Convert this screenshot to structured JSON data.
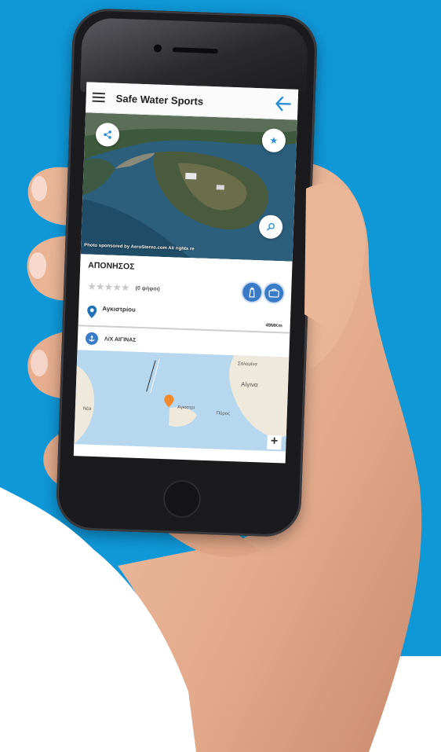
{
  "app": {
    "title": "Safe Water Sports"
  },
  "photo": {
    "credit": "Photo sponsored by AeroStereo.com All rights re"
  },
  "place": {
    "name": "ΑΠΟΝΗΣΟΣ",
    "rating_stars": "★★★★★",
    "rating_votes": "(0 ψήφοι)",
    "location": "Αγκιστρίου",
    "distance": "49ΜKm",
    "port": "Λ/Χ ΑΙΓΙΝΑΣ"
  },
  "map": {
    "labels": [
      "Σαλαμίνα",
      "Αίγινα",
      "Νέα",
      "Αγκιστρι",
      "Πόρος"
    ],
    "zoom_in": "+"
  },
  "colors": {
    "background": "#0f98d8",
    "accent": "#3a7bc8",
    "marker": "#f08a2c"
  },
  "icons": [
    "menu-icon",
    "back-arrow-icon",
    "share-icon",
    "star-icon",
    "zoom-icon",
    "lighthouse-icon",
    "bag-icon",
    "location-pin-icon",
    "anchor-icon",
    "map-marker-icon"
  ]
}
